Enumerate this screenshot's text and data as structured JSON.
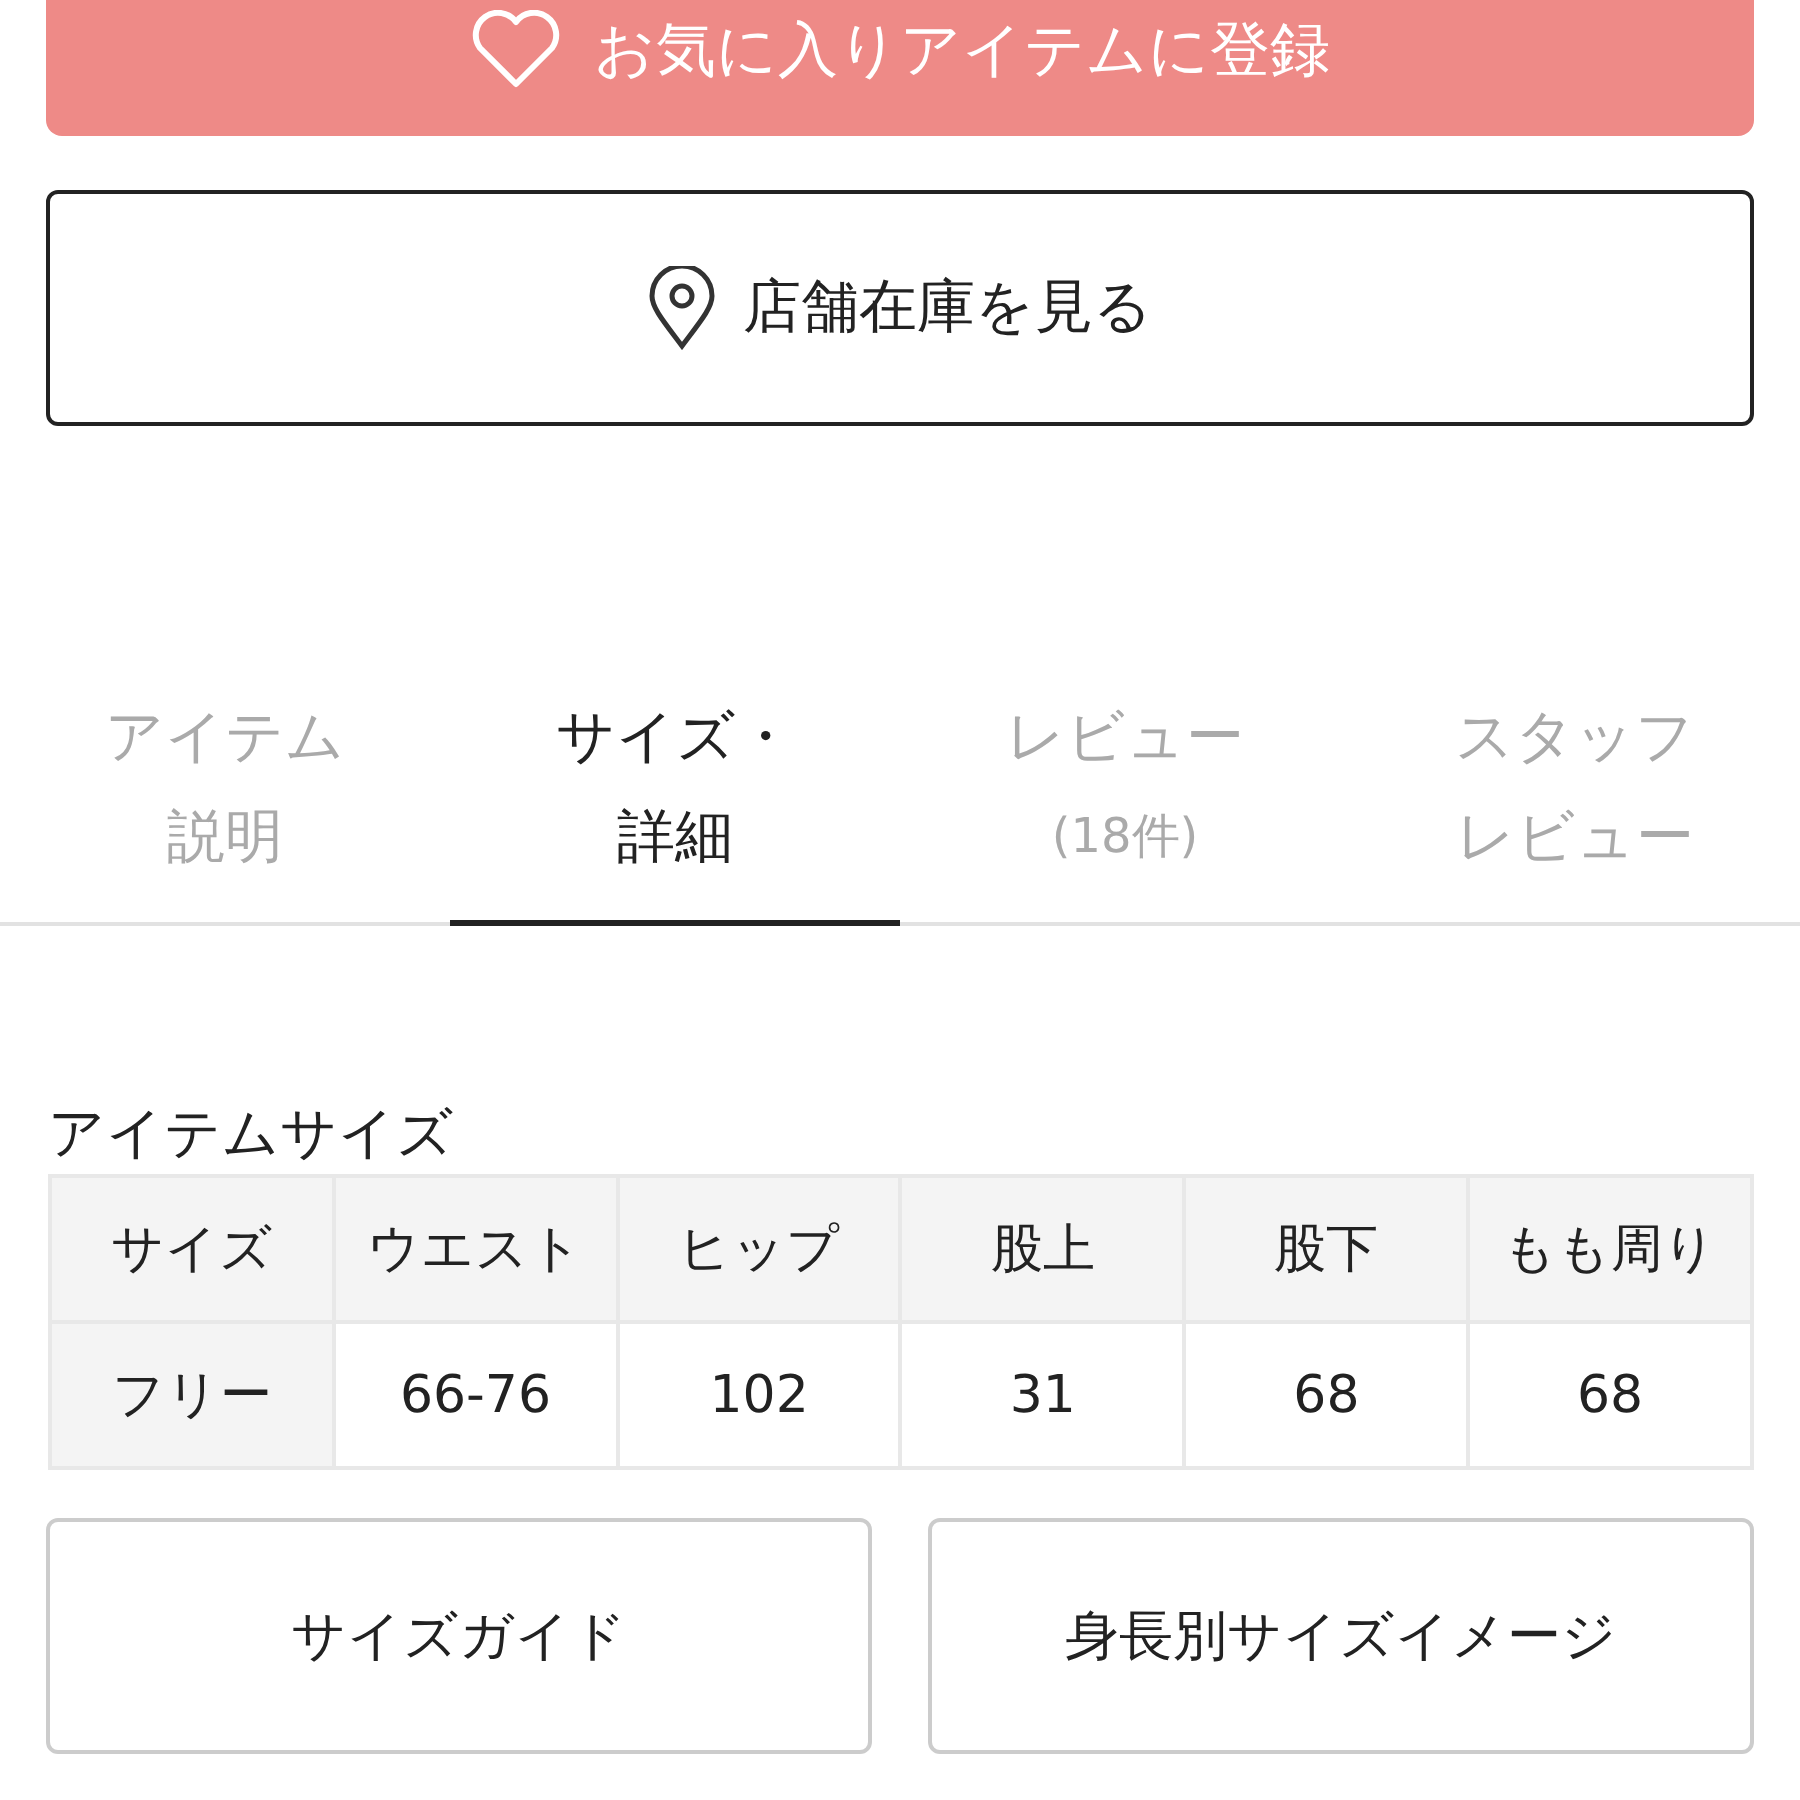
{
  "favorite_button": {
    "label": "お気に入りアイテムに登録"
  },
  "store_stock_button": {
    "label": "店舗在庫を見る"
  },
  "tabs": [
    {
      "lines": [
        "アイテム",
        "説明"
      ],
      "selected": false
    },
    {
      "lines": [
        "サイズ・",
        "詳細"
      ],
      "selected": true
    },
    {
      "lines": [
        "レビュー"
      ],
      "count": "(18件)",
      "selected": false
    },
    {
      "lines": [
        "スタッフ",
        "レビュー"
      ],
      "selected": false
    }
  ],
  "size_table": {
    "title": "アイテムサイズ",
    "columns": [
      "サイズ",
      "ウエスト",
      "ヒップ",
      "股上",
      "股下",
      "もも周り"
    ],
    "rows": [
      [
        "フリー",
        "66-76",
        "102",
        "31",
        "68",
        "68"
      ]
    ]
  },
  "buttons": [
    "サイズガイド",
    "身長別サイズイメージ"
  ]
}
